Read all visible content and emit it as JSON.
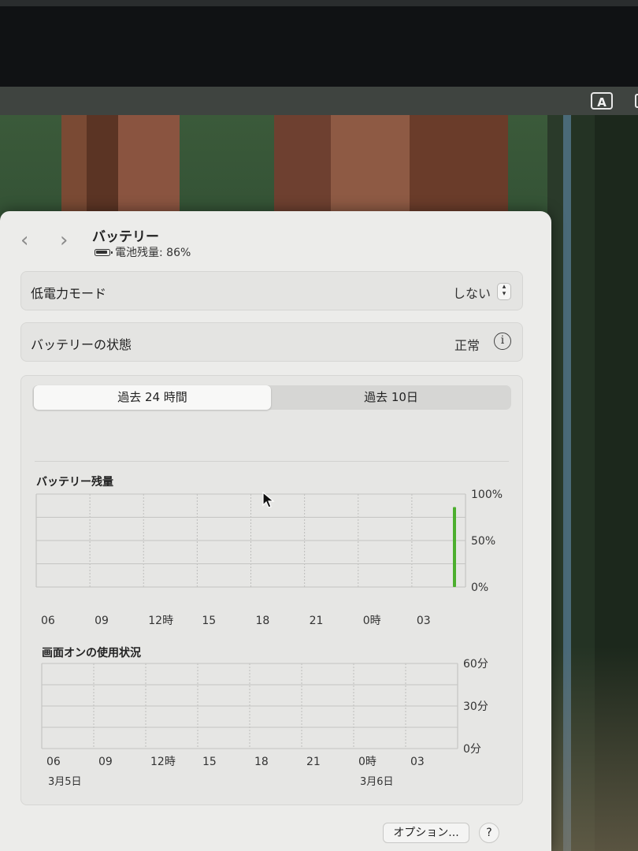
{
  "menubar": {
    "input_source": "A"
  },
  "window": {
    "title": "バッテリー",
    "battery_status": "電池残量: 86%",
    "nav": {
      "back": "‹",
      "forward": "›"
    }
  },
  "low_power": {
    "label": "低電力モード",
    "value": "しない"
  },
  "battery_health": {
    "label": "バッテリーの状態",
    "value": "正常"
  },
  "tabs": [
    {
      "label": "過去 24 時間",
      "selected": true
    },
    {
      "label": "過去 10日",
      "selected": false
    }
  ],
  "buttons": {
    "options": "オプション...",
    "help": "?"
  },
  "colors": {
    "battery_bar": "#4caf2e",
    "accent": "#ececea"
  },
  "chart_data": [
    {
      "type": "bar",
      "title": "バッテリー残量",
      "x_labels": [
        "06",
        "09",
        "12時",
        "15",
        "18",
        "21",
        "0時",
        "03"
      ],
      "y_labels": [
        "100%",
        "50%",
        "0%"
      ],
      "ylim": [
        0,
        100
      ],
      "series": [
        {
          "values": [
            {
              "x": "05:00",
              "y": 86
            }
          ]
        }
      ],
      "grid": true
    },
    {
      "type": "bar",
      "title": "画面オンの使用状況",
      "x_labels": [
        "06",
        "09",
        "12時",
        "15",
        "18",
        "21",
        "0時",
        "03"
      ],
      "date_labels": [
        "3月5日",
        "3月6日"
      ],
      "y_labels": [
        "60分",
        "30分",
        "0分"
      ],
      "ylim": [
        0,
        60
      ],
      "series": [
        {
          "values": []
        }
      ],
      "grid": true
    }
  ]
}
